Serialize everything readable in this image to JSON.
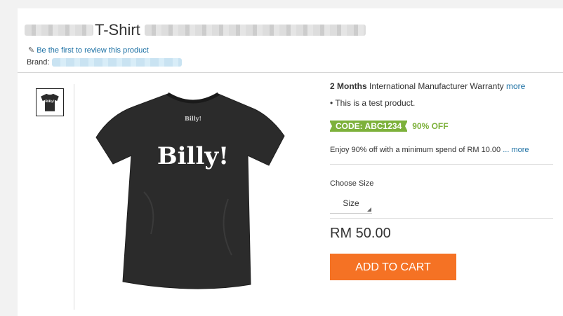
{
  "product": {
    "title": "T-Shirt",
    "review_link": "Be the first to review this product",
    "brand_label": "Brand:",
    "shirt_print": "Billy!"
  },
  "details": {
    "warranty_bold": "2 Months",
    "warranty_text": "International Manufacturer Warranty",
    "warranty_more": "more",
    "bullet": "This is a test product.",
    "voucher_code": "CODE: ABC1234",
    "voucher_off": "90% OFF",
    "voucher_desc": "Enjoy 90% off with a minimum spend of RM 10.00",
    "voucher_more": "... more",
    "choose_size_label": "Choose Size",
    "size_value": "Size",
    "price": "RM 50.00",
    "add_to_cart": "ADD TO CART"
  },
  "colors": {
    "accent_orange": "#f57224",
    "voucher_green": "#7db13b",
    "link_blue": "#1a6fa3",
    "shirt": "#2b2b2b"
  },
  "icons": {
    "review": "pencil-icon",
    "dropdown": "caret-icon"
  }
}
